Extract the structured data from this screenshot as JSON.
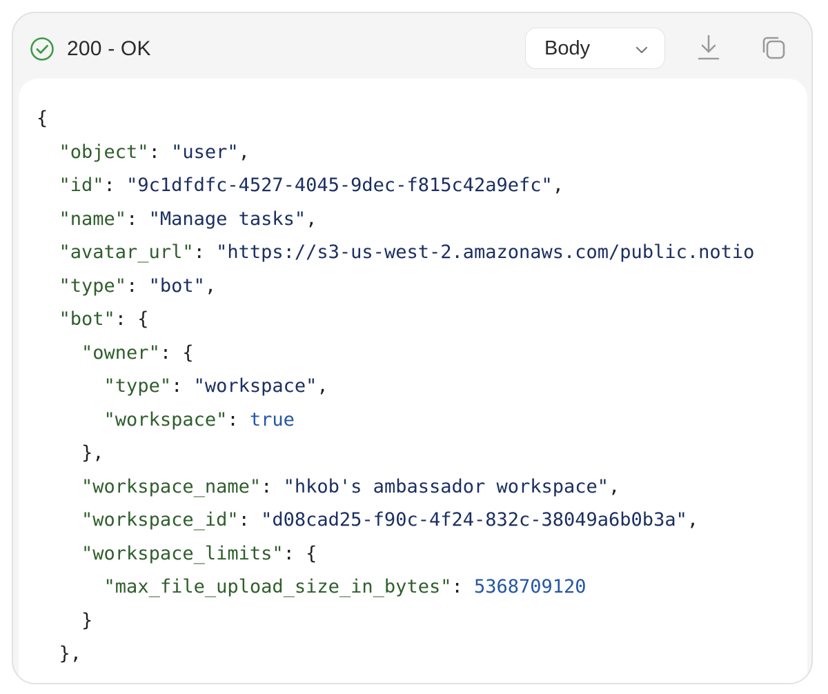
{
  "status": {
    "code_text": "200 - OK",
    "color": "#3e9b48"
  },
  "format_select": {
    "selected": "Body"
  },
  "icons": {
    "status": "check-circle-icon",
    "select": "chevron-down-icon",
    "download": "download-icon",
    "copy": "copy-icon"
  },
  "json_lines": [
    {
      "indent": 0,
      "parts": [
        {
          "t": "p",
          "v": "{"
        }
      ]
    },
    {
      "indent": 1,
      "parts": [
        {
          "t": "k",
          "v": "\"object\""
        },
        {
          "t": "p",
          "v": ": "
        },
        {
          "t": "s",
          "v": "\"user\""
        },
        {
          "t": "p",
          "v": ","
        }
      ]
    },
    {
      "indent": 1,
      "parts": [
        {
          "t": "k",
          "v": "\"id\""
        },
        {
          "t": "p",
          "v": ": "
        },
        {
          "t": "s",
          "v": "\"9c1dfdfc-4527-4045-9dec-f815c42a9efc\""
        },
        {
          "t": "p",
          "v": ","
        }
      ]
    },
    {
      "indent": 1,
      "parts": [
        {
          "t": "k",
          "v": "\"name\""
        },
        {
          "t": "p",
          "v": ": "
        },
        {
          "t": "s",
          "v": "\"Manage tasks\""
        },
        {
          "t": "p",
          "v": ","
        }
      ]
    },
    {
      "indent": 1,
      "parts": [
        {
          "t": "k",
          "v": "\"avatar_url\""
        },
        {
          "t": "p",
          "v": ": "
        },
        {
          "t": "s",
          "v": "\"https://s3-us-west-2.amazonaws.com/public.notio"
        }
      ]
    },
    {
      "indent": 1,
      "parts": [
        {
          "t": "k",
          "v": "\"type\""
        },
        {
          "t": "p",
          "v": ": "
        },
        {
          "t": "s",
          "v": "\"bot\""
        },
        {
          "t": "p",
          "v": ","
        }
      ]
    },
    {
      "indent": 1,
      "parts": [
        {
          "t": "k",
          "v": "\"bot\""
        },
        {
          "t": "p",
          "v": ": {"
        }
      ]
    },
    {
      "indent": 2,
      "parts": [
        {
          "t": "k",
          "v": "\"owner\""
        },
        {
          "t": "p",
          "v": ": {"
        }
      ]
    },
    {
      "indent": 3,
      "parts": [
        {
          "t": "k",
          "v": "\"type\""
        },
        {
          "t": "p",
          "v": ": "
        },
        {
          "t": "s",
          "v": "\"workspace\""
        },
        {
          "t": "p",
          "v": ","
        }
      ]
    },
    {
      "indent": 3,
      "parts": [
        {
          "t": "k",
          "v": "\"workspace\""
        },
        {
          "t": "p",
          "v": ": "
        },
        {
          "t": "n",
          "v": "true"
        }
      ]
    },
    {
      "indent": 2,
      "parts": [
        {
          "t": "p",
          "v": "},"
        }
      ]
    },
    {
      "indent": 2,
      "parts": [
        {
          "t": "k",
          "v": "\"workspace_name\""
        },
        {
          "t": "p",
          "v": ": "
        },
        {
          "t": "s",
          "v": "\"hkob's ambassador workspace\""
        },
        {
          "t": "p",
          "v": ","
        }
      ]
    },
    {
      "indent": 2,
      "parts": [
        {
          "t": "k",
          "v": "\"workspace_id\""
        },
        {
          "t": "p",
          "v": ": "
        },
        {
          "t": "s",
          "v": "\"d08cad25-f90c-4f24-832c-38049a6b0b3a\""
        },
        {
          "t": "p",
          "v": ","
        }
      ]
    },
    {
      "indent": 2,
      "parts": [
        {
          "t": "k",
          "v": "\"workspace_limits\""
        },
        {
          "t": "p",
          "v": ": {"
        }
      ]
    },
    {
      "indent": 3,
      "parts": [
        {
          "t": "k",
          "v": "\"max_file_upload_size_in_bytes\""
        },
        {
          "t": "p",
          "v": ": "
        },
        {
          "t": "n",
          "v": "5368709120"
        }
      ]
    },
    {
      "indent": 2,
      "parts": [
        {
          "t": "p",
          "v": "}"
        }
      ]
    },
    {
      "indent": 1,
      "parts": [
        {
          "t": "p",
          "v": "},"
        }
      ]
    }
  ]
}
